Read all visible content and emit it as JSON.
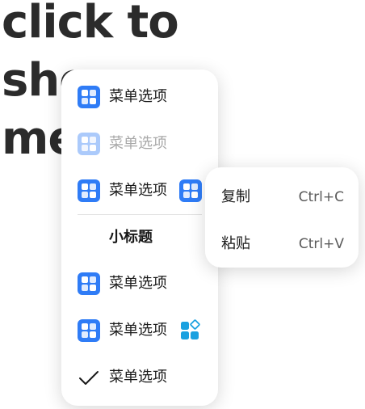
{
  "background": {
    "line1": "click to",
    "line2": "sho",
    "line3": "me"
  },
  "menu": {
    "items": [
      {
        "label": "菜单选项",
        "icon": "grid-app-icon",
        "state": "normal"
      },
      {
        "label": "菜单选项",
        "icon": "grid-app-icon",
        "state": "disabled"
      },
      {
        "label": "菜单选项",
        "icon": "grid-app-icon",
        "state": "normal",
        "trailing_icon": "grid-app-icon"
      },
      {
        "label": "菜单选项",
        "icon": "grid-app-icon",
        "state": "normal"
      },
      {
        "label": "菜单选项",
        "icon": "grid-app-icon",
        "state": "normal",
        "trailing_icon": "apps-diamond-icon"
      },
      {
        "label": "菜单选项",
        "icon": "checkmark-icon",
        "state": "checked"
      }
    ],
    "subtitle": "小标题"
  },
  "submenu": {
    "items": [
      {
        "label": "复制",
        "shortcut": "Ctrl+C"
      },
      {
        "label": "粘贴",
        "shortcut": "Ctrl+V"
      }
    ]
  },
  "colors": {
    "icon_blue": "#2f7cf6",
    "icon_blue_light": "#9fc3fb",
    "accent_teal": "#1aa1e0",
    "text_primary": "#191919",
    "text_disabled": "#a8a8a8"
  }
}
